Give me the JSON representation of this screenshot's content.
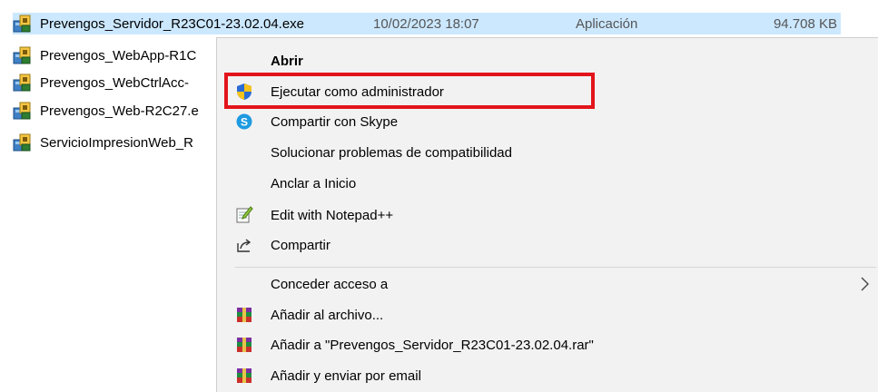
{
  "files": [
    {
      "name": "Prevengos_Servidor_R23C01-23.02.04.exe",
      "date": "10/02/2023 18:07",
      "type": "Aplicación",
      "size": "94.708 KB",
      "selected": true
    },
    {
      "name": "Prevengos_WebApp-R1C"
    },
    {
      "name": "Prevengos_WebCtrlAcc-"
    },
    {
      "name": "Prevengos_Web-R2C27.e"
    },
    {
      "name": "ServicioImpresionWeb_R"
    }
  ],
  "context_menu": {
    "items": [
      {
        "label": "Abrir",
        "icon": "none",
        "bold": true
      },
      {
        "label": "Ejecutar como administrador",
        "icon": "uac-shield-icon"
      },
      {
        "label": "Compartir con Skype",
        "icon": "skype-icon"
      },
      {
        "label": "Solucionar problemas de compatibilidad",
        "icon": "none"
      },
      {
        "label": "Anclar a Inicio",
        "icon": "none"
      },
      {
        "label": "Edit with Notepad++",
        "icon": "notepadpp-icon"
      },
      {
        "label": "Compartir",
        "icon": "share-icon"
      },
      {
        "label": "Conceder acceso a",
        "icon": "none",
        "submenu": true
      },
      {
        "label": "Añadir al archivo...",
        "icon": "winrar-icon"
      },
      {
        "label": "Añadir a \"Prevengos_Servidor_R23C01-23.02.04.rar\"",
        "icon": "winrar-icon"
      },
      {
        "label": "Añadir y enviar por email",
        "icon": "winrar-icon"
      }
    ]
  },
  "colors": {
    "selection": "#cce8ff",
    "menu_bg": "#f2f2f2",
    "highlight": "#e3141b"
  }
}
